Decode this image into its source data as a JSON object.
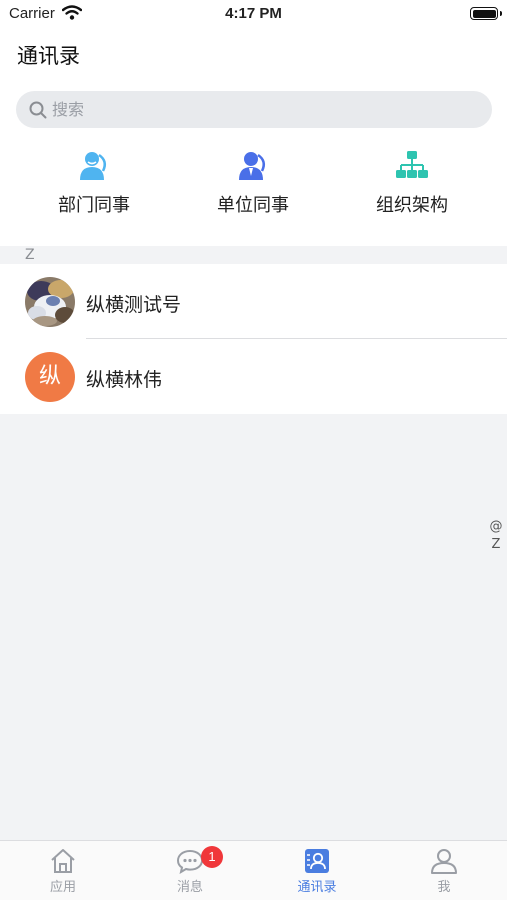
{
  "status_bar": {
    "carrier": "Carrier",
    "time": "4:17 PM"
  },
  "header": {
    "title": "通讯录"
  },
  "search": {
    "placeholder": "搜索"
  },
  "quick_links": [
    {
      "label": "部门同事",
      "icon": "department-colleagues-icon",
      "color": "#4fb4f0"
    },
    {
      "label": "单位同事",
      "icon": "unit-colleagues-icon",
      "color": "#4a6fe8"
    },
    {
      "label": "组织架构",
      "icon": "org-chart-icon",
      "color": "#2ec4b0"
    }
  ],
  "contacts": {
    "section": "Z",
    "items": [
      {
        "name": "纵横测试号",
        "avatar": "photo"
      },
      {
        "name": "纵横林伟",
        "avatar_text": "纵",
        "avatar_color": "#f07a45"
      }
    ]
  },
  "index_bar": [
    "@",
    "Z"
  ],
  "tab_bar": {
    "tabs": [
      {
        "label": "应用",
        "icon": "home-icon"
      },
      {
        "label": "消息",
        "icon": "chat-icon",
        "badge": "1"
      },
      {
        "label": "通讯录",
        "icon": "contacts-icon",
        "active": true
      },
      {
        "label": "我",
        "icon": "person-icon"
      }
    ],
    "active_color": "#4a7de0",
    "badge_color": "#f0373a"
  }
}
